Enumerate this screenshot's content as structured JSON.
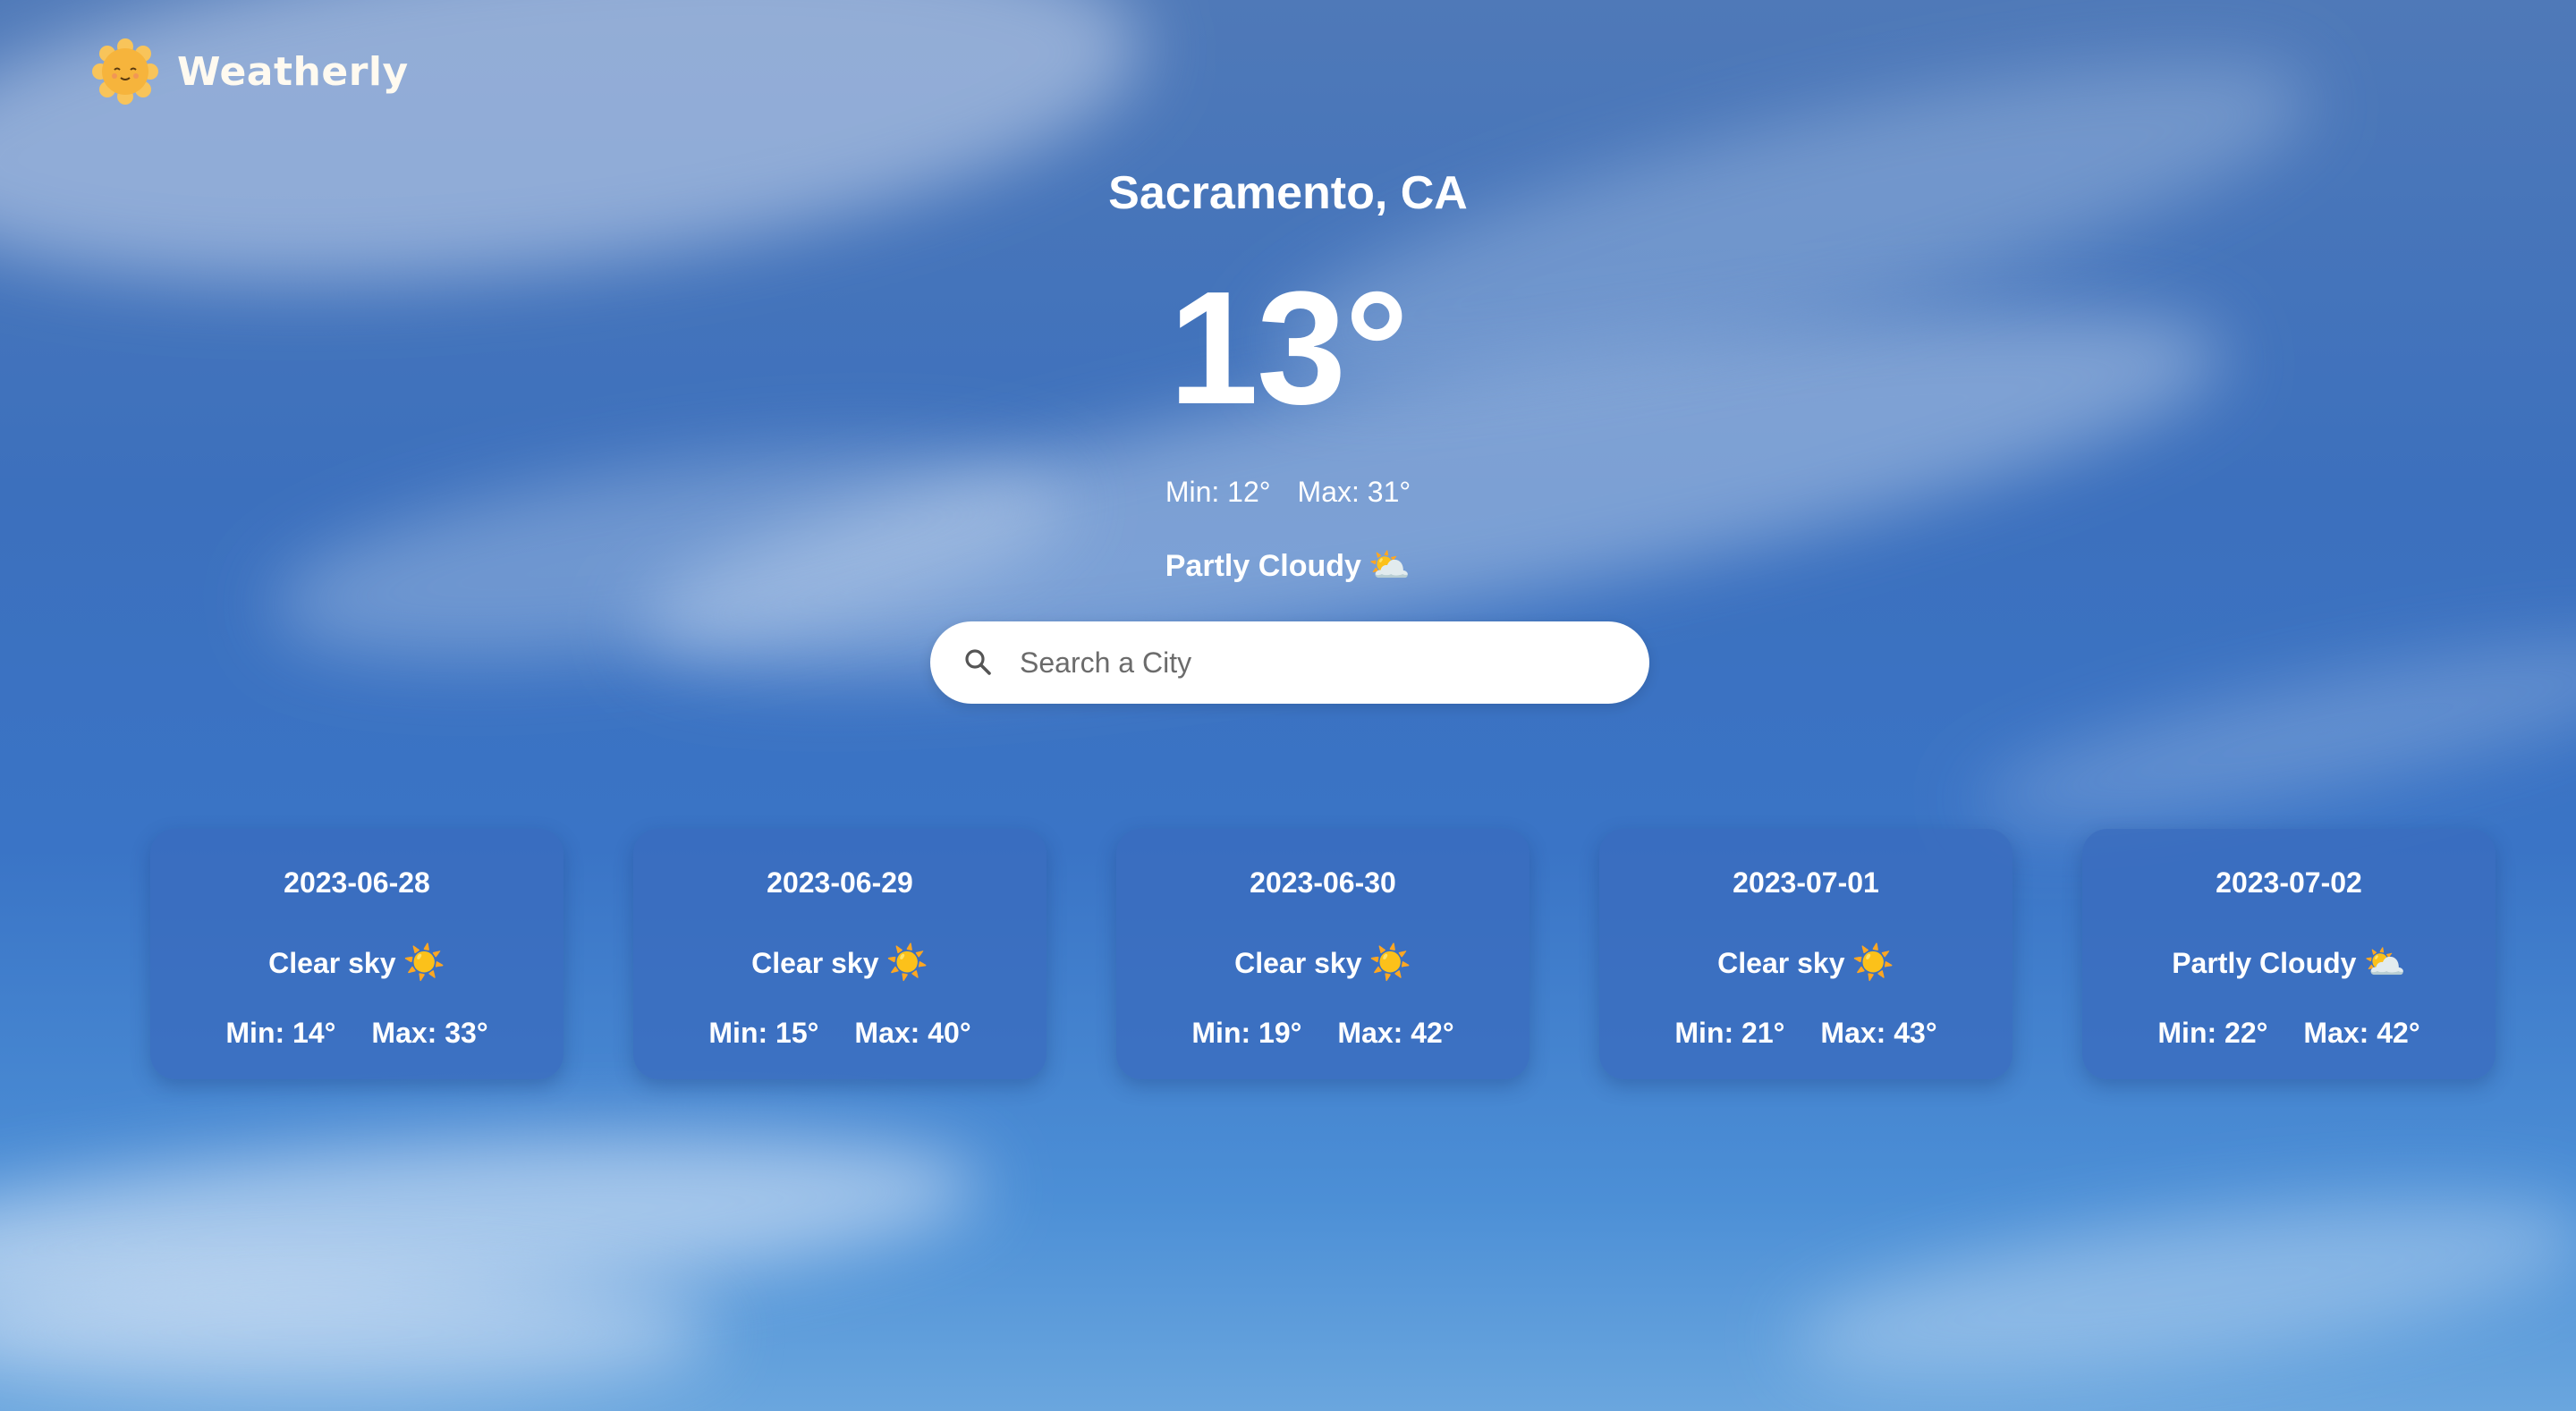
{
  "app": {
    "name": "Weatherly"
  },
  "current": {
    "city": "Sacramento, CA",
    "temperature": "13°",
    "min": "Min: 12°",
    "max": "Max: 31°",
    "condition": "Partly Cloudy",
    "condition_icon": "⛅"
  },
  "search": {
    "placeholder": "Search a City",
    "value": ""
  },
  "forecast": [
    {
      "date": "2023-06-28",
      "condition": "Clear sky",
      "icon": "☀️",
      "min": "Min: 14°",
      "max": "Max: 33°"
    },
    {
      "date": "2023-06-29",
      "condition": "Clear sky",
      "icon": "☀️",
      "min": "Min: 15°",
      "max": "Max: 40°"
    },
    {
      "date": "2023-06-30",
      "condition": "Clear sky",
      "icon": "☀️",
      "min": "Min: 19°",
      "max": "Max: 42°"
    },
    {
      "date": "2023-07-01",
      "condition": "Clear sky",
      "icon": "☀️",
      "min": "Min: 21°",
      "max": "Max: 43°"
    },
    {
      "date": "2023-07-02",
      "condition": "Partly Cloudy",
      "icon": "⛅",
      "min": "Min: 22°",
      "max": "Max: 42°"
    }
  ],
  "colors": {
    "sky": "#3c70bd",
    "card": "#3a6cbe",
    "logo_sun": "#f6b43c"
  }
}
